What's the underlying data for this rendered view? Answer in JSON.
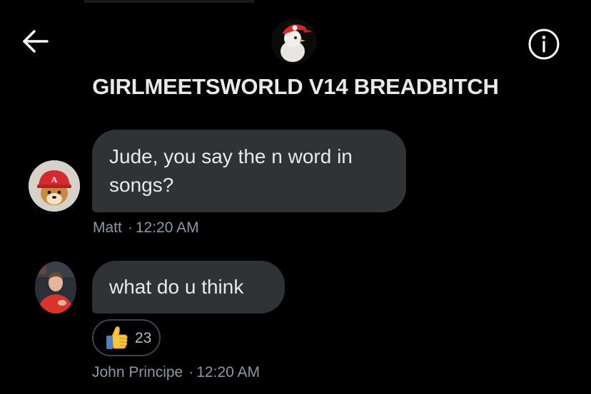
{
  "header": {
    "back_icon": "arrow-left-icon",
    "info_icon": "info-icon",
    "group_title": "GIRLMEETSWORLD V14 BREADBITCH"
  },
  "messages": [
    {
      "sender": "Matt",
      "time": "12:20 AM",
      "text_lines": [
        "Jude, you say the n word in",
        "songs?"
      ],
      "reactions": []
    },
    {
      "sender": "John Principe",
      "time": "12:20 AM",
      "text_lines": [
        "what do u think"
      ],
      "reactions": [
        {
          "emoji": "thumbs-up-icon",
          "count": "23"
        }
      ]
    }
  ],
  "separator": "·",
  "colors": {
    "background": "#000000",
    "bubble": "#2f3336",
    "text": "#e7e9ea",
    "meta_text": "#8b98a5"
  }
}
